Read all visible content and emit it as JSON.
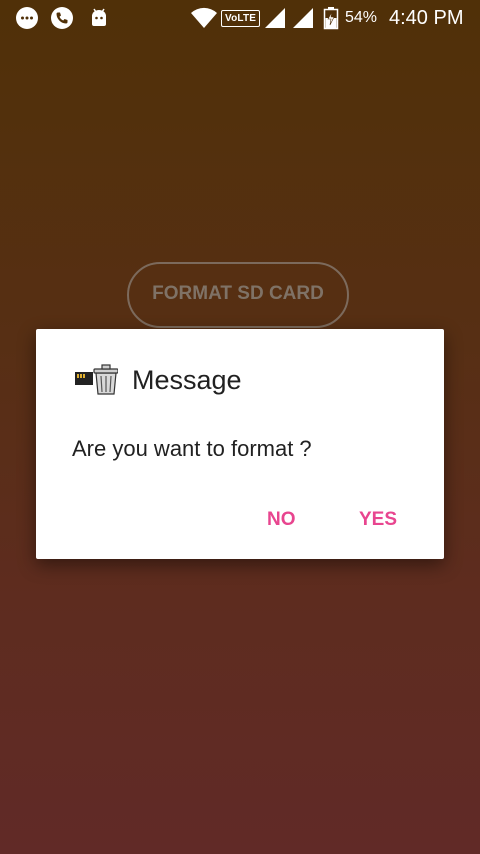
{
  "status_bar": {
    "volte_label": "VoLTE",
    "battery_percent": "54%",
    "time": "4:40 PM",
    "icons": [
      "message-icon",
      "phone-icon",
      "android-icon",
      "wifi-icon",
      "signal-icon",
      "signal-icon",
      "battery-charging-icon"
    ]
  },
  "main": {
    "format_button_label": "FORMAT SD CARD"
  },
  "dialog": {
    "icon": "sd-card-trash-icon",
    "title": "Message",
    "message": "Are you want to format ?",
    "no_label": "NO",
    "yes_label": "YES"
  },
  "colors": {
    "accent": "#e8458f",
    "background_top": "#503008",
    "background_bottom": "#612a27"
  }
}
